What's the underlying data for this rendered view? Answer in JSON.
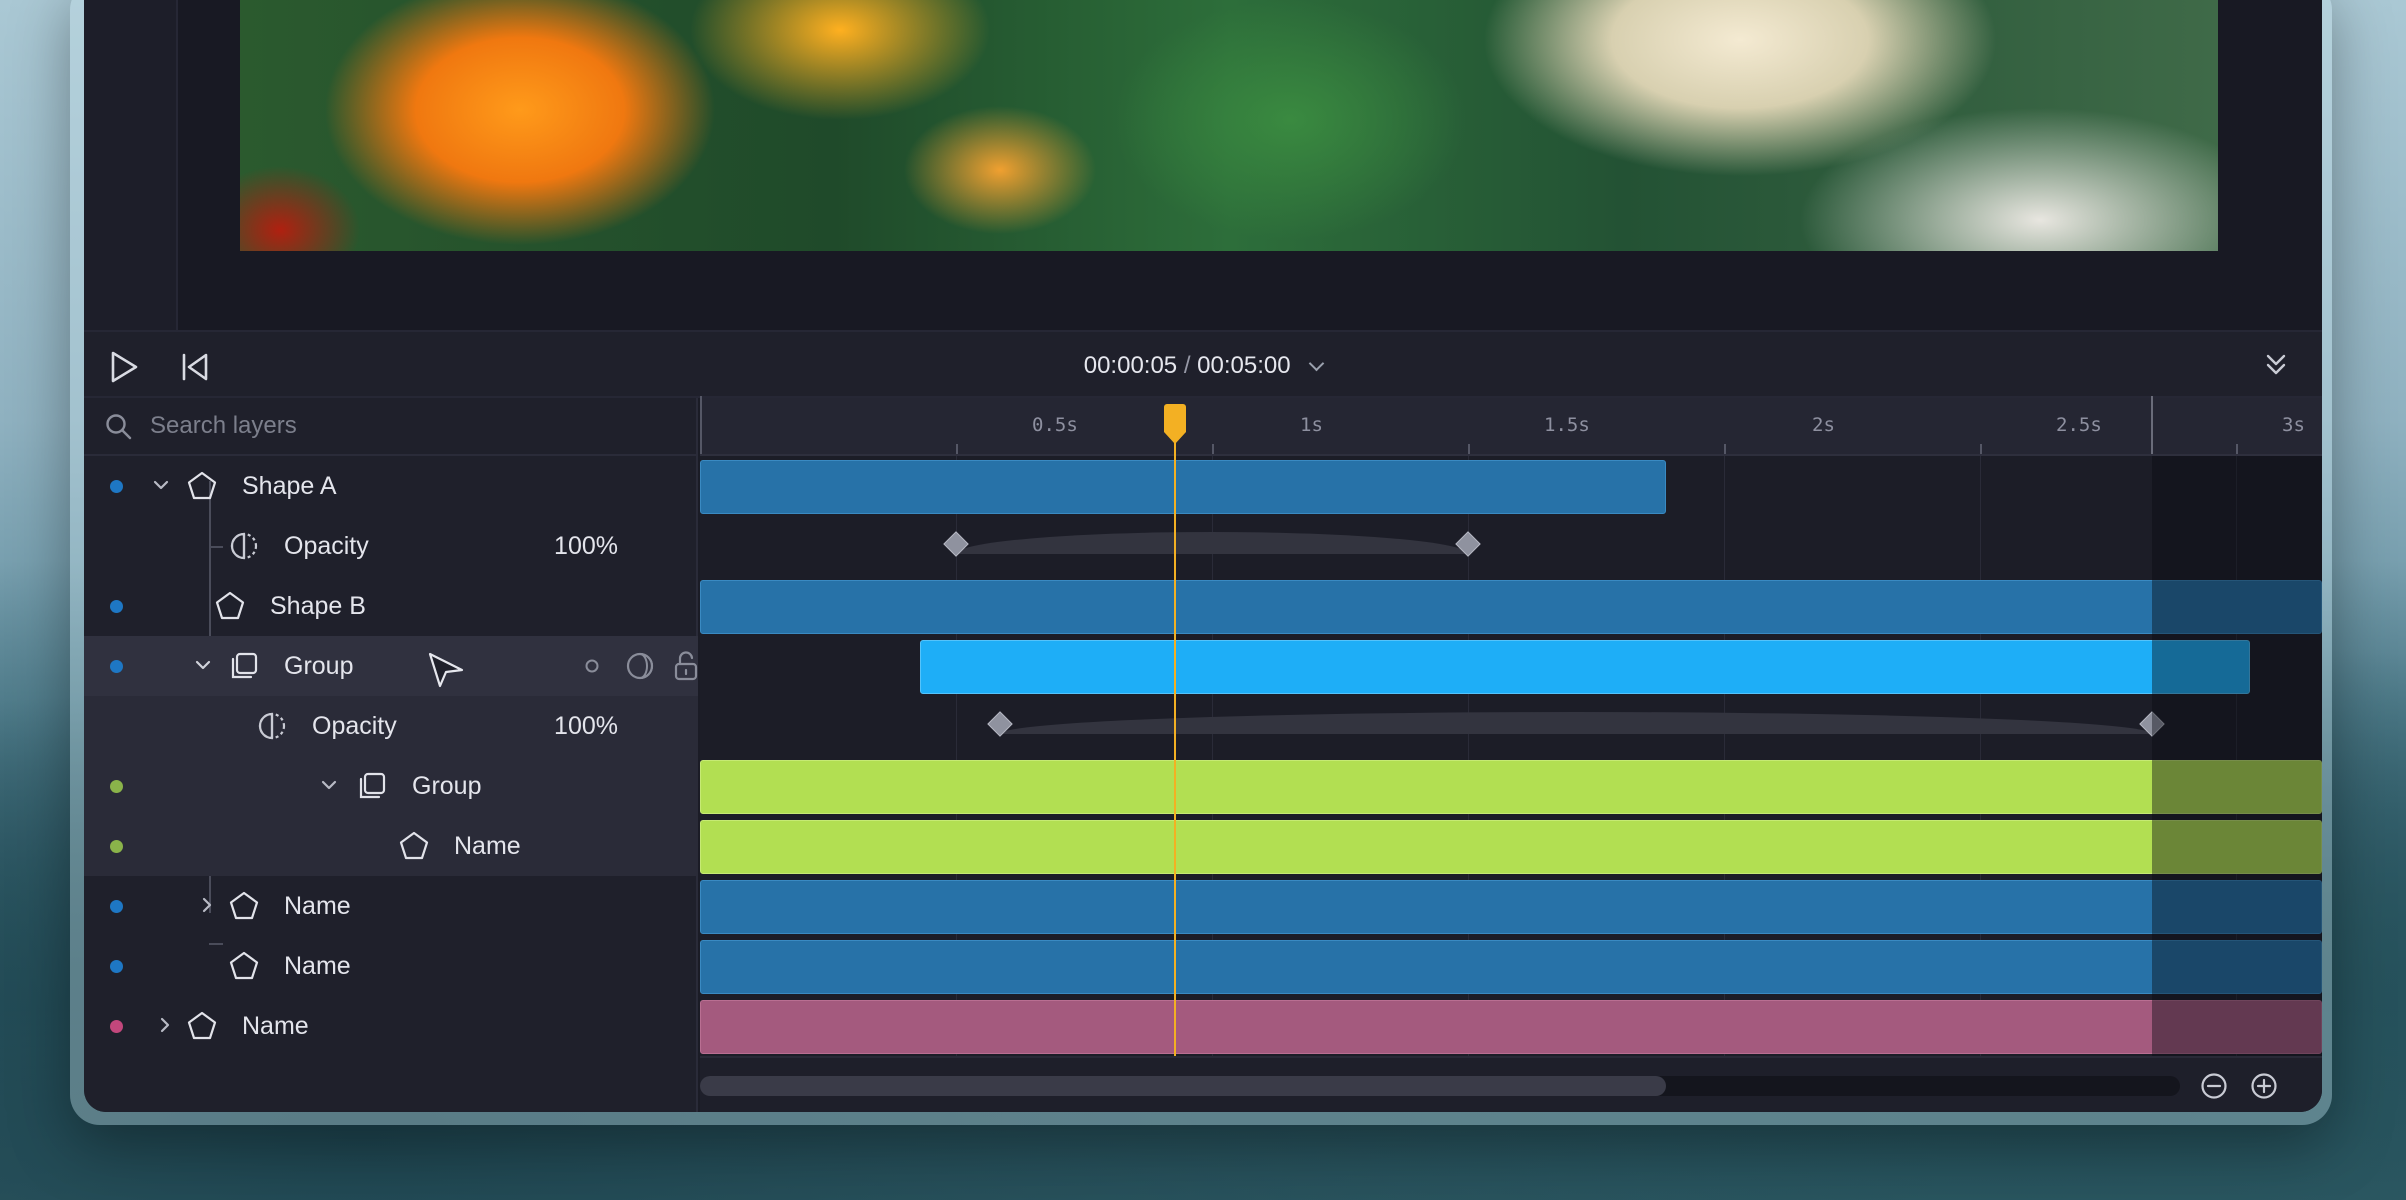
{
  "playback": {
    "current_time": "00:00:05",
    "separator": "/",
    "total_time": "00:05:00"
  },
  "layers_panel": {
    "search_placeholder": "Search layers",
    "rows": [
      {
        "label": "Shape A",
        "type": "shape",
        "color": "#1e77c4",
        "expanded": true
      },
      {
        "label": "Opacity",
        "type": "property",
        "value": "100%"
      },
      {
        "label": "Shape B",
        "type": "shape",
        "color": "#1e77c4"
      },
      {
        "label": "Group",
        "type": "group",
        "color": "#1e77c4",
        "expanded": true,
        "selected": true
      },
      {
        "label": "Opacity",
        "type": "property",
        "value": "100%"
      },
      {
        "label": "Group",
        "type": "group",
        "color": "#8ab34a",
        "expanded": true
      },
      {
        "label": "Name",
        "type": "shape",
        "color": "#8ab34a"
      },
      {
        "label": "Name",
        "type": "shape",
        "color": "#1e77c4",
        "collapsed": true
      },
      {
        "label": "Name",
        "type": "shape",
        "color": "#1e77c4"
      },
      {
        "label": "Name",
        "type": "shape",
        "color": "#c2477c",
        "collapsed": true
      }
    ]
  },
  "timeline": {
    "ruler_labels": [
      "0.5s",
      "1s",
      "1.5s",
      "2s",
      "2.5s",
      "3s"
    ],
    "playhead_seconds": 0.73,
    "colors": {
      "blue": "#2772a8",
      "cyan": "#1eaef7",
      "lime": "#b2df52",
      "pink": "#a45a7e",
      "playhead": "#f3b023"
    }
  },
  "icons": [
    "play-icon",
    "skip-to-start-icon",
    "chevron-down-icon",
    "collapse-panel-icon",
    "search-icon",
    "pentagon-shape-icon",
    "opacity-icon",
    "keyframe-diamond-icon",
    "group-icon",
    "circle-icon",
    "blend-icon",
    "unlock-icon",
    "eye-icon",
    "cursor-icon",
    "zoom-out-icon",
    "zoom-in-icon"
  ]
}
